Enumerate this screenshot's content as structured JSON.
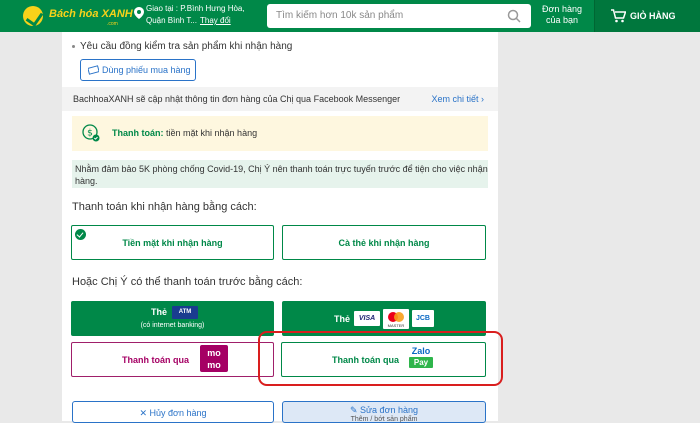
{
  "header": {
    "logo_text": "Bách hóa XANH",
    "logo_sub": ".com",
    "location_line1": "Giao tại : P.Bình Hưng Hòa,",
    "location_line2": "Quận Bình T...",
    "location_change": "Thay đổi",
    "search_placeholder": "Tìm kiếm hơn 10k sản phẩm",
    "orders_label_1": "Đơn hàng",
    "orders_label_2": "của bạn",
    "cart_label": "GIỎ HÀNG"
  },
  "checkout": {
    "inspect_note": "Yêu cầu đồng kiểm tra sản phẩm khi nhận hàng",
    "voucher_button": "Dùng phiếu mua hàng",
    "messenger_note": "BachhoaXANH sẽ cập nhật thông tin đơn hàng của Chị qua Facebook Messenger",
    "see_more": "Xem chi tiết ›",
    "payment_label": "Thanh toán:",
    "payment_value": "tiền mặt khi nhận hàng",
    "covid_note": "Nhằm đảm bảo 5K phòng chống Covid-19, Chị Ý nên thanh toán trực tuyến trước để tiện cho việc nhận hàng.",
    "cod_heading": "Thanh toán khi nhận hàng bằng cách:",
    "cod_cash": "Tiền mặt khi nhận hàng",
    "cod_card": "Cà thẻ khi nhận hàng",
    "prepay_heading": "Hoặc Chị Ý có thể thanh toán trước bằng cách:",
    "atm_label": "Thẻ",
    "atm_badge": "ATM",
    "atm_sub": "(có internet banking)",
    "intl_label": "Thẻ",
    "visa": "VISA",
    "master": "MASTER",
    "jcb": "JCB",
    "momo_label": "Thanh toán qua",
    "momo_logo_1": "mo",
    "momo_logo_2": "mo",
    "zalo_label": "Thanh toán qua",
    "zalo_logo_1": "Zalo",
    "zalo_logo_2": "Pay",
    "cancel_button": "✕ Hủy đơn hàng",
    "edit_button": "✎ Sửa đơn hàng",
    "edit_sub": "Thêm / bớt sản phẩm"
  },
  "colors": {
    "brand": "#008848",
    "accent": "#2a73c8",
    "highlight": "#d91e1e"
  }
}
